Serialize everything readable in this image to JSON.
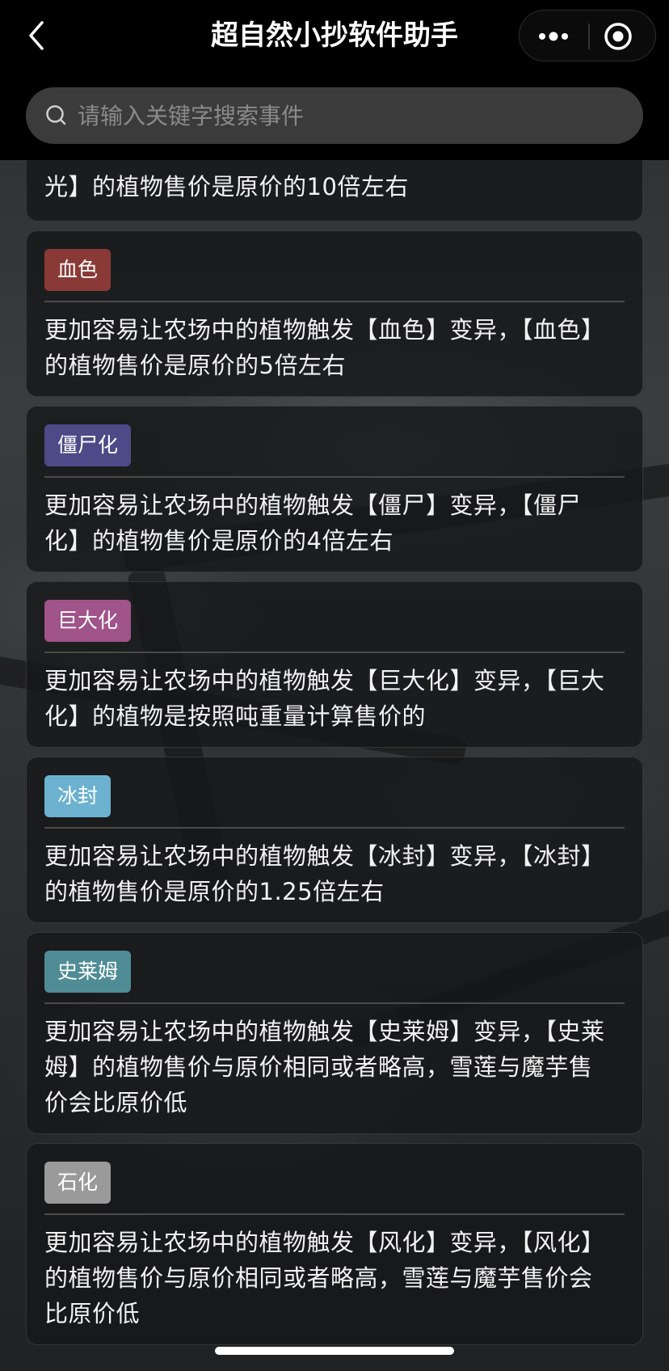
{
  "header": {
    "title": "超自然小抄软件助手"
  },
  "search": {
    "placeholder": "请输入关键字搜索事件",
    "value": ""
  },
  "cards": [
    {
      "tag": "",
      "tag_color": "",
      "description": "光】的植物售价是原价的10倍左右"
    },
    {
      "tag": "血色",
      "tag_color": "#8a3a36",
      "description": "更加容易让农场中的植物触发【血色】变异，【血色】的植物售价是原价的5倍左右"
    },
    {
      "tag": "僵尸化",
      "tag_color": "#4e4a88",
      "description": "更加容易让农场中的植物触发【僵尸】变异，【僵尸化】的植物售价是原价的4倍左右"
    },
    {
      "tag": "巨大化",
      "tag_color": "#a0548a",
      "description": "更加容易让农场中的植物触发【巨大化】变异，【巨大化】的植物是按照吨重量计算售价的"
    },
    {
      "tag": "冰封",
      "tag_color": "#6cb1cf",
      "description": "更加容易让农场中的植物触发【冰封】变异，【冰封】的植物售价是原价的1.25倍左右"
    },
    {
      "tag": "史莱姆",
      "tag_color": "#4f8c96",
      "description": "更加容易让农场中的植物触发【史莱姆】变异，【史莱姆】的植物售价与原价相同或者略高，雪莲与魔芋售价会比原价低"
    },
    {
      "tag": "石化",
      "tag_color": "#9a9a9a",
      "description": "更加容易让农场中的植物触发【风化】变异，【风化】的植物售价与原价相同或者略高，雪莲与魔芋售价会比原价低"
    }
  ]
}
